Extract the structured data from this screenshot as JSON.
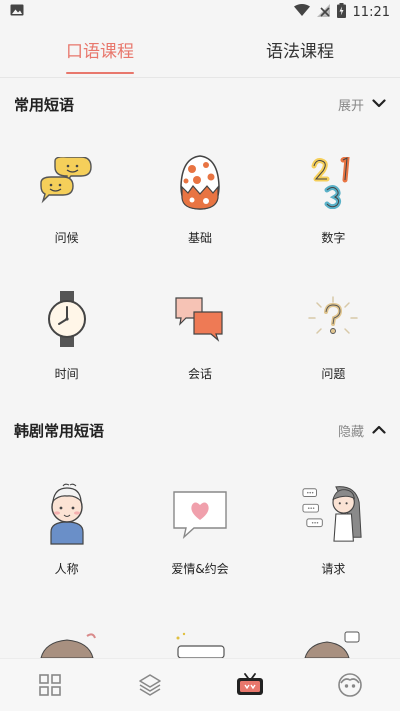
{
  "status": {
    "time": "11:21"
  },
  "tabs": [
    {
      "label": "口语课程",
      "active": true
    },
    {
      "label": "语法课程",
      "active": false
    }
  ],
  "sections": [
    {
      "title": "常用短语",
      "toggle": "展开",
      "items": [
        "问候",
        "基础",
        "数字",
        "时间",
        "会话",
        "问题"
      ]
    },
    {
      "title": "韩剧常用短语",
      "toggle": "隐藏",
      "items": [
        "人称",
        "爱情&约会",
        "请求"
      ]
    }
  ],
  "colors": {
    "accent": "#e8776c",
    "background": "#f5f5f5"
  }
}
